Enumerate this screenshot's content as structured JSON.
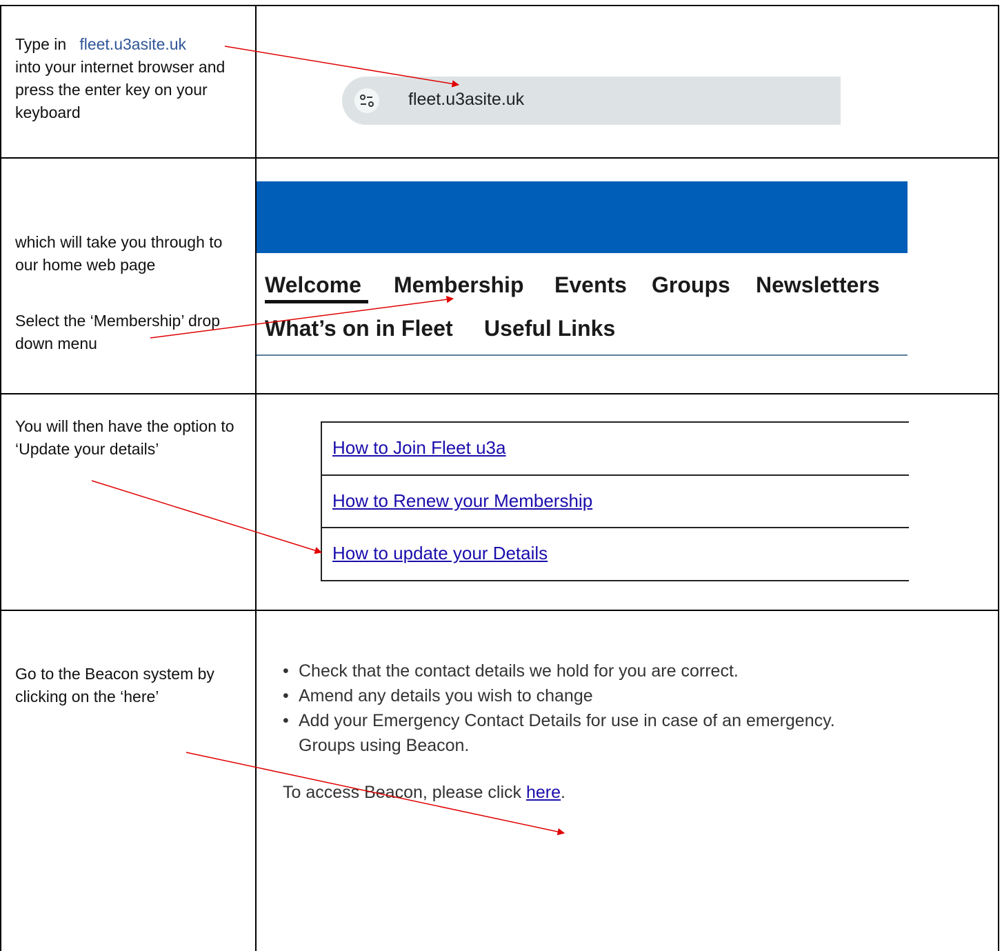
{
  "row1": {
    "instruction_prefix": "Type in",
    "instruction_url": "fleet.u3asite.uk",
    "instruction_rest": "into your internet browser and press the enter key on your keyboard",
    "address_bar_url": "fleet.u3asite.uk",
    "address_bar_icon": "tune-icon"
  },
  "row2": {
    "instruction_1": "which will take you through to our home web page",
    "instruction_2": "Select the ‘Membership’ drop down menu",
    "banner_color": "#005eb8",
    "nav_items": [
      "Welcome",
      "Membership",
      "Events",
      "Groups",
      "Newsletters",
      "What’s on in Fleet",
      "Useful Links"
    ],
    "active_item": "Welcome"
  },
  "row3": {
    "instruction": "You will then have the option to ‘Update your details’",
    "menu_items": [
      "How to Join Fleet u3a",
      "How to Renew your Membership",
      "How to update your Details"
    ]
  },
  "row4": {
    "instruction": "Go to the Beacon system by clicking on the ‘here’",
    "bullets": [
      "Check that the contact details we hold for you are correct.",
      "Amend any details you wish to change",
      "Add your Emergency Contact Details for use in case of an emergency.",
      "Groups using Beacon."
    ],
    "access_text": "To access Beacon, please click",
    "access_link": "here",
    "access_end": "."
  },
  "annotation_color": "#e00000"
}
